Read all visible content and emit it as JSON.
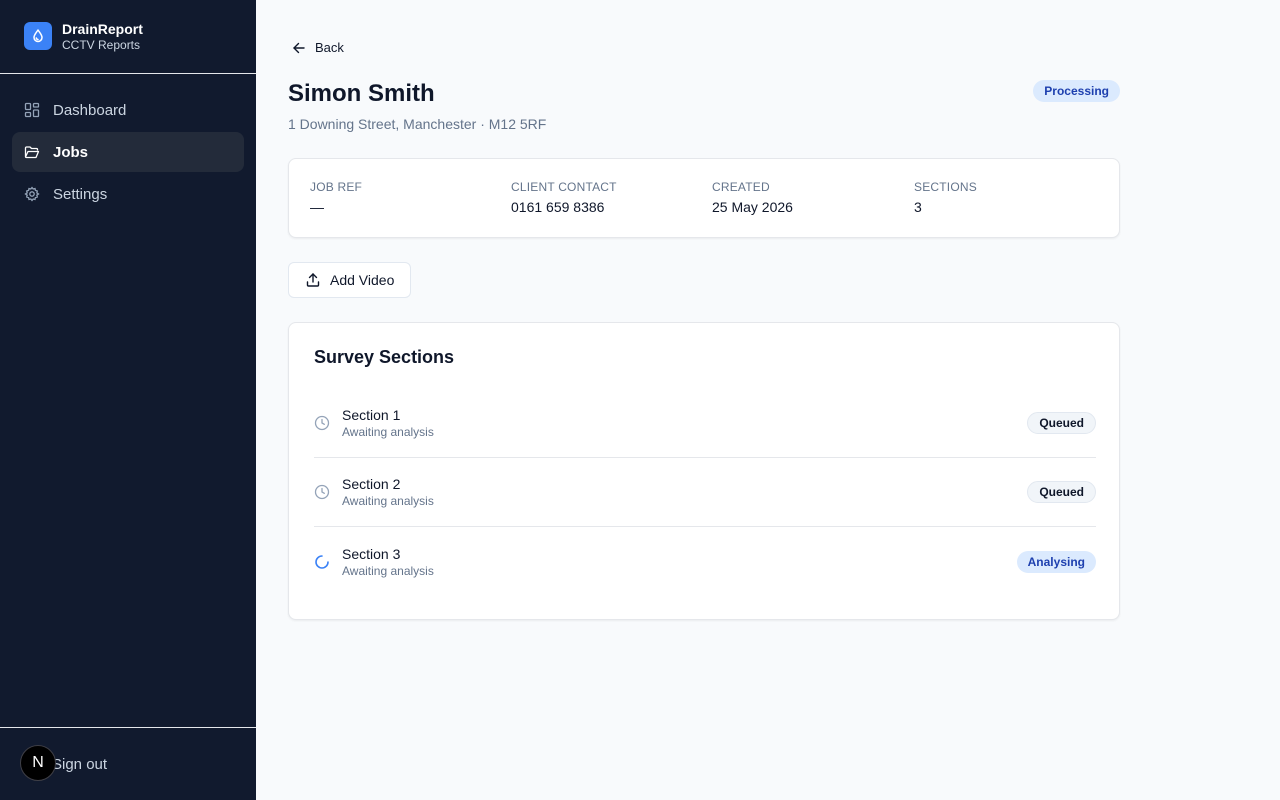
{
  "sidebar": {
    "brand_name": "DrainReport",
    "brand_sub": "CCTV Reports",
    "items": [
      {
        "label": "Dashboard",
        "icon": "dashboard-icon"
      },
      {
        "label": "Jobs",
        "icon": "folder-icon",
        "active": true
      },
      {
        "label": "Settings",
        "icon": "gear-icon"
      }
    ],
    "signout_label": "Sign out",
    "avatar_letter": "N"
  },
  "main": {
    "back_label": "Back",
    "title": "Simon Smith",
    "address": "1 Downing Street, Manchester · M12 5RF",
    "status": "Processing",
    "info": [
      {
        "label": "JOB REF",
        "value": "—"
      },
      {
        "label": "CLIENT CONTACT",
        "value": "0161 659 8386"
      },
      {
        "label": "CREATED",
        "value": "25 May 2026"
      },
      {
        "label": "SECTIONS",
        "value": "3"
      }
    ],
    "add_video_label": "Add Video",
    "sections_title": "Survey Sections",
    "sections": [
      {
        "name": "Section 1",
        "sub": "Awaiting analysis",
        "status": "Queued",
        "icon": "clock-icon"
      },
      {
        "name": "Section 2",
        "sub": "Awaiting analysis",
        "status": "Queued",
        "icon": "clock-icon"
      },
      {
        "name": "Section 3",
        "sub": "Awaiting analysis",
        "status": "Analysing",
        "icon": "spinner-icon"
      }
    ]
  },
  "colors": {
    "sidebar_bg": "#111a2e",
    "accent": "#3b82f6",
    "badge_blue_bg": "#dbeafe",
    "badge_blue_text": "#1e40af"
  }
}
